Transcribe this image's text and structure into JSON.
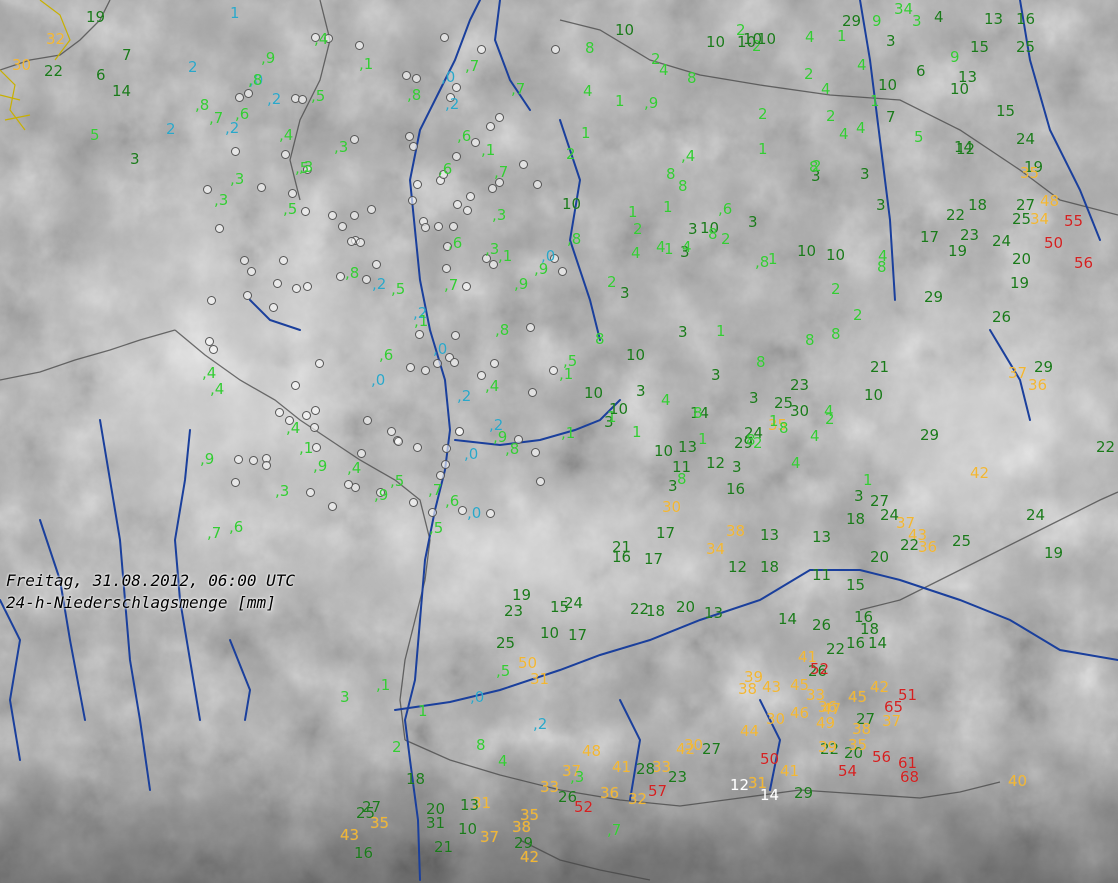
{
  "caption": {
    "line1": "Freitag, 31.08.2012, 06:00 UTC",
    "line2": "24-h-Niederschlagsmenge [mm]"
  },
  "legend_colors": {
    "trace": "#2aa7c9",
    "low": "#33cc33",
    "medium": "#1a7a1a",
    "high": "#f2b632",
    "very_high": "#d42020",
    "label": "#ffffff",
    "rivers": "#1a3f9c",
    "borders": "#444444"
  },
  "dry_stations": 120,
  "readings": [
    {
      "v": "19",
      "c": "medium"
    },
    {
      "v": "1",
      "c": "trace"
    },
    {
      "v": "32",
      "c": "high"
    },
    {
      "v": "30",
      "c": "high"
    },
    {
      "v": "22",
      "c": "medium"
    },
    {
      "v": "6",
      "c": "medium"
    },
    {
      "v": "7",
      "c": "medium"
    },
    {
      "v": "14",
      "c": "medium"
    },
    {
      "v": "2",
      "c": "trace"
    },
    {
      "v": "5",
      "c": "low"
    },
    {
      "v": "2",
      "c": "trace"
    },
    {
      "v": "3",
      "c": "medium"
    },
    {
      "v": "29",
      "c": "medium"
    },
    {
      "v": "9",
      "c": "low"
    },
    {
      "v": "34",
      "c": "low"
    },
    {
      "v": "3",
      "c": "low"
    },
    {
      "v": "4",
      "c": "medium"
    },
    {
      "v": "13",
      "c": "medium"
    },
    {
      "v": "16",
      "c": "medium"
    },
    {
      "v": "15",
      "c": "medium"
    },
    {
      "v": "25",
      "c": "medium"
    },
    {
      "v": "3",
      "c": "medium"
    },
    {
      "v": "6",
      "c": "medium"
    },
    {
      "v": "9",
      "c": "low"
    },
    {
      "v": "10",
      "c": "medium"
    },
    {
      "v": "13",
      "c": "medium"
    },
    {
      "v": "15",
      "c": "medium"
    },
    {
      "v": "7",
      "c": "medium"
    },
    {
      "v": "5",
      "c": "low"
    },
    {
      "v": "14",
      "c": "medium"
    },
    {
      "v": "24",
      "c": "medium"
    },
    {
      "v": "12",
      "c": "medium"
    },
    {
      "v": "19",
      "c": "medium"
    },
    {
      "v": "35",
      "c": "high"
    },
    {
      "v": "48",
      "c": "high"
    },
    {
      "v": "34",
      "c": "high"
    },
    {
      "v": "55",
      "c": "very_high"
    },
    {
      "v": "50",
      "c": "very_high"
    },
    {
      "v": "56",
      "c": "very_high"
    },
    {
      "v": "27",
      "c": "medium"
    },
    {
      "v": "25",
      "c": "medium"
    },
    {
      "v": "22",
      "c": "medium"
    },
    {
      "v": "17",
      "c": "medium"
    },
    {
      "v": "23",
      "c": "medium"
    },
    {
      "v": "24",
      "c": "medium"
    },
    {
      "v": "19",
      "c": "medium"
    },
    {
      "v": "18",
      "c": "medium"
    },
    {
      "v": "20",
      "c": "medium"
    },
    {
      "v": "29",
      "c": "medium"
    },
    {
      "v": "26",
      "c": "medium"
    },
    {
      "v": "19",
      "c": "medium"
    },
    {
      "v": "37",
      "c": "high"
    },
    {
      "v": "36",
      "c": "high"
    },
    {
      "v": "29",
      "c": "medium"
    },
    {
      "v": "22",
      "c": "medium"
    },
    {
      "v": "42",
      "c": "high"
    },
    {
      "v": "24",
      "c": "medium"
    },
    {
      "v": "19",
      "c": "medium"
    },
    {
      "v": "25",
      "c": "medium"
    },
    {
      "v": "29",
      "c": "medium"
    },
    {
      "v": "37",
      "c": "high"
    },
    {
      "v": "43",
      "c": "high"
    },
    {
      "v": "36",
      "c": "high"
    },
    {
      "v": "21",
      "c": "medium"
    },
    {
      "v": "27",
      "c": "medium"
    },
    {
      "v": "24",
      "c": "medium"
    },
    {
      "v": "18",
      "c": "medium"
    },
    {
      "v": "13",
      "c": "medium"
    },
    {
      "v": "11",
      "c": "medium"
    },
    {
      "v": "22",
      "c": "medium"
    },
    {
      "v": "20",
      "c": "medium"
    },
    {
      "v": "15",
      "c": "medium"
    },
    {
      "v": "16",
      "c": "medium"
    },
    {
      "v": "18",
      "c": "medium"
    },
    {
      "v": "14",
      "c": "medium"
    },
    {
      "v": "16",
      "c": "medium"
    },
    {
      "v": "22",
      "c": "medium"
    },
    {
      "v": "26",
      "c": "medium"
    },
    {
      "v": "18",
      "c": "medium"
    },
    {
      "v": "30",
      "c": "medium"
    },
    {
      "v": "25",
      "c": "medium"
    },
    {
      "v": "24",
      "c": "medium"
    },
    {
      "v": "35",
      "c": "high"
    },
    {
      "v": "29",
      "c": "medium"
    },
    {
      "v": "23",
      "c": "medium"
    },
    {
      "v": "14",
      "c": "medium"
    },
    {
      "v": "13",
      "c": "medium"
    },
    {
      "v": "11",
      "c": "medium"
    },
    {
      "v": "12",
      "c": "medium"
    },
    {
      "v": "16",
      "c": "medium"
    },
    {
      "v": "30",
      "c": "high"
    },
    {
      "v": "34",
      "c": "high"
    },
    {
      "v": "38",
      "c": "high"
    },
    {
      "v": "17",
      "c": "medium"
    },
    {
      "v": "21",
      "c": "medium"
    },
    {
      "v": "17",
      "c": "medium"
    },
    {
      "v": "13",
      "c": "medium"
    },
    {
      "v": "12",
      "c": "medium"
    },
    {
      "v": "16",
      "c": "medium"
    },
    {
      "v": "10",
      "c": "medium"
    },
    {
      "v": "50",
      "c": "high"
    },
    {
      "v": "31",
      "c": "high"
    },
    {
      "v": "25",
      "c": "medium"
    },
    {
      "v": "24",
      "c": "medium"
    },
    {
      "v": "23",
      "c": "medium"
    },
    {
      "v": "19",
      "c": "medium"
    },
    {
      "v": "15",
      "c": "medium"
    },
    {
      "v": "17",
      "c": "medium"
    },
    {
      "v": "22",
      "c": "medium"
    },
    {
      "v": "18",
      "c": "medium"
    },
    {
      "v": "13",
      "c": "medium"
    },
    {
      "v": "20",
      "c": "medium"
    },
    {
      "v": "14",
      "c": "medium"
    },
    {
      "v": "26",
      "c": "medium"
    },
    {
      "v": "41",
      "c": "high"
    },
    {
      "v": "52",
      "c": "very_high"
    },
    {
      "v": "45",
      "c": "high"
    },
    {
      "v": "43",
      "c": "high"
    },
    {
      "v": "33",
      "c": "high"
    },
    {
      "v": "36",
      "c": "high"
    },
    {
      "v": "39",
      "c": "high"
    },
    {
      "v": "38",
      "c": "high"
    },
    {
      "v": "30",
      "c": "high"
    },
    {
      "v": "46",
      "c": "high"
    },
    {
      "v": "49",
      "c": "high"
    },
    {
      "v": "45",
      "c": "high"
    },
    {
      "v": "47",
      "c": "high"
    },
    {
      "v": "65",
      "c": "very_high"
    },
    {
      "v": "27",
      "c": "medium"
    },
    {
      "v": "42",
      "c": "high"
    },
    {
      "v": "51",
      "c": "very_high"
    },
    {
      "v": "37",
      "c": "high"
    },
    {
      "v": "22",
      "c": "medium"
    },
    {
      "v": "20",
      "c": "medium"
    },
    {
      "v": "38",
      "c": "high"
    },
    {
      "v": "35",
      "c": "high"
    },
    {
      "v": "56",
      "c": "very_high"
    },
    {
      "v": "61",
      "c": "very_high"
    },
    {
      "v": "68",
      "c": "very_high"
    },
    {
      "v": "54",
      "c": "very_high"
    },
    {
      "v": "44",
      "c": "high"
    },
    {
      "v": "39",
      "c": "high"
    },
    {
      "v": "50",
      "c": "very_high"
    },
    {
      "v": "41",
      "c": "high"
    },
    {
      "v": "31",
      "c": "high"
    },
    {
      "v": "12",
      "c": "label"
    },
    {
      "v": "14",
      "c": "label"
    },
    {
      "v": "29",
      "c": "medium"
    },
    {
      "v": "40",
      "c": "high"
    },
    {
      "v": "42",
      "c": "high"
    },
    {
      "v": "30",
      "c": "high"
    },
    {
      "v": "27",
      "c": "medium"
    },
    {
      "v": "23",
      "c": "medium"
    },
    {
      "v": "33",
      "c": "high"
    },
    {
      "v": "28",
      "c": "medium"
    },
    {
      "v": "57",
      "c": "very_high"
    },
    {
      "v": "48",
      "c": "high"
    },
    {
      "v": "41",
      "c": "high"
    },
    {
      "v": "37",
      "c": "high"
    },
    {
      "v": "36",
      "c": "high"
    },
    {
      "v": "32",
      "c": "high"
    },
    {
      "v": "33",
      "c": "high"
    },
    {
      "v": "26",
      "c": "medium"
    },
    {
      "v": "52",
      "c": "very_high"
    },
    {
      "v": "35",
      "c": "high"
    },
    {
      "v": "42",
      "c": "high"
    },
    {
      "v": "38",
      "c": "high"
    },
    {
      "v": "31",
      "c": "medium"
    },
    {
      "v": "37",
      "c": "high"
    },
    {
      "v": "29",
      "c": "medium"
    },
    {
      "v": "21",
      "c": "medium"
    },
    {
      "v": "27",
      "c": "medium"
    },
    {
      "v": "18",
      "c": "medium"
    },
    {
      "v": "31",
      "c": "high"
    },
    {
      "v": "43",
      "c": "high"
    },
    {
      "v": "16",
      "c": "medium"
    },
    {
      "v": "25",
      "c": "medium"
    },
    {
      "v": "35",
      "c": "high"
    },
    {
      "v": "20",
      "c": "medium"
    },
    {
      "v": "13",
      "c": "medium"
    },
    {
      "v": "10",
      "c": "medium"
    },
    {
      "v": "8",
      "c": "low"
    },
    {
      "v": "4",
      "c": "low"
    },
    {
      "v": "3",
      "c": "low"
    },
    {
      "v": "2",
      "c": "low"
    },
    {
      "v": "1",
      "c": "low"
    },
    {
      "v": ",1",
      "c": "low"
    },
    {
      "v": ",0",
      "c": "trace"
    },
    {
      "v": ",5",
      "c": "low"
    },
    {
      "v": ",2",
      "c": "trace"
    },
    {
      "v": ",3",
      "c": "low"
    },
    {
      "v": ",7",
      "c": "low"
    },
    {
      "v": ",9",
      "c": "low"
    },
    {
      "v": ",4",
      "c": "low"
    },
    {
      "v": ",6",
      "c": "low"
    },
    {
      "v": ",8",
      "c": "low"
    }
  ]
}
